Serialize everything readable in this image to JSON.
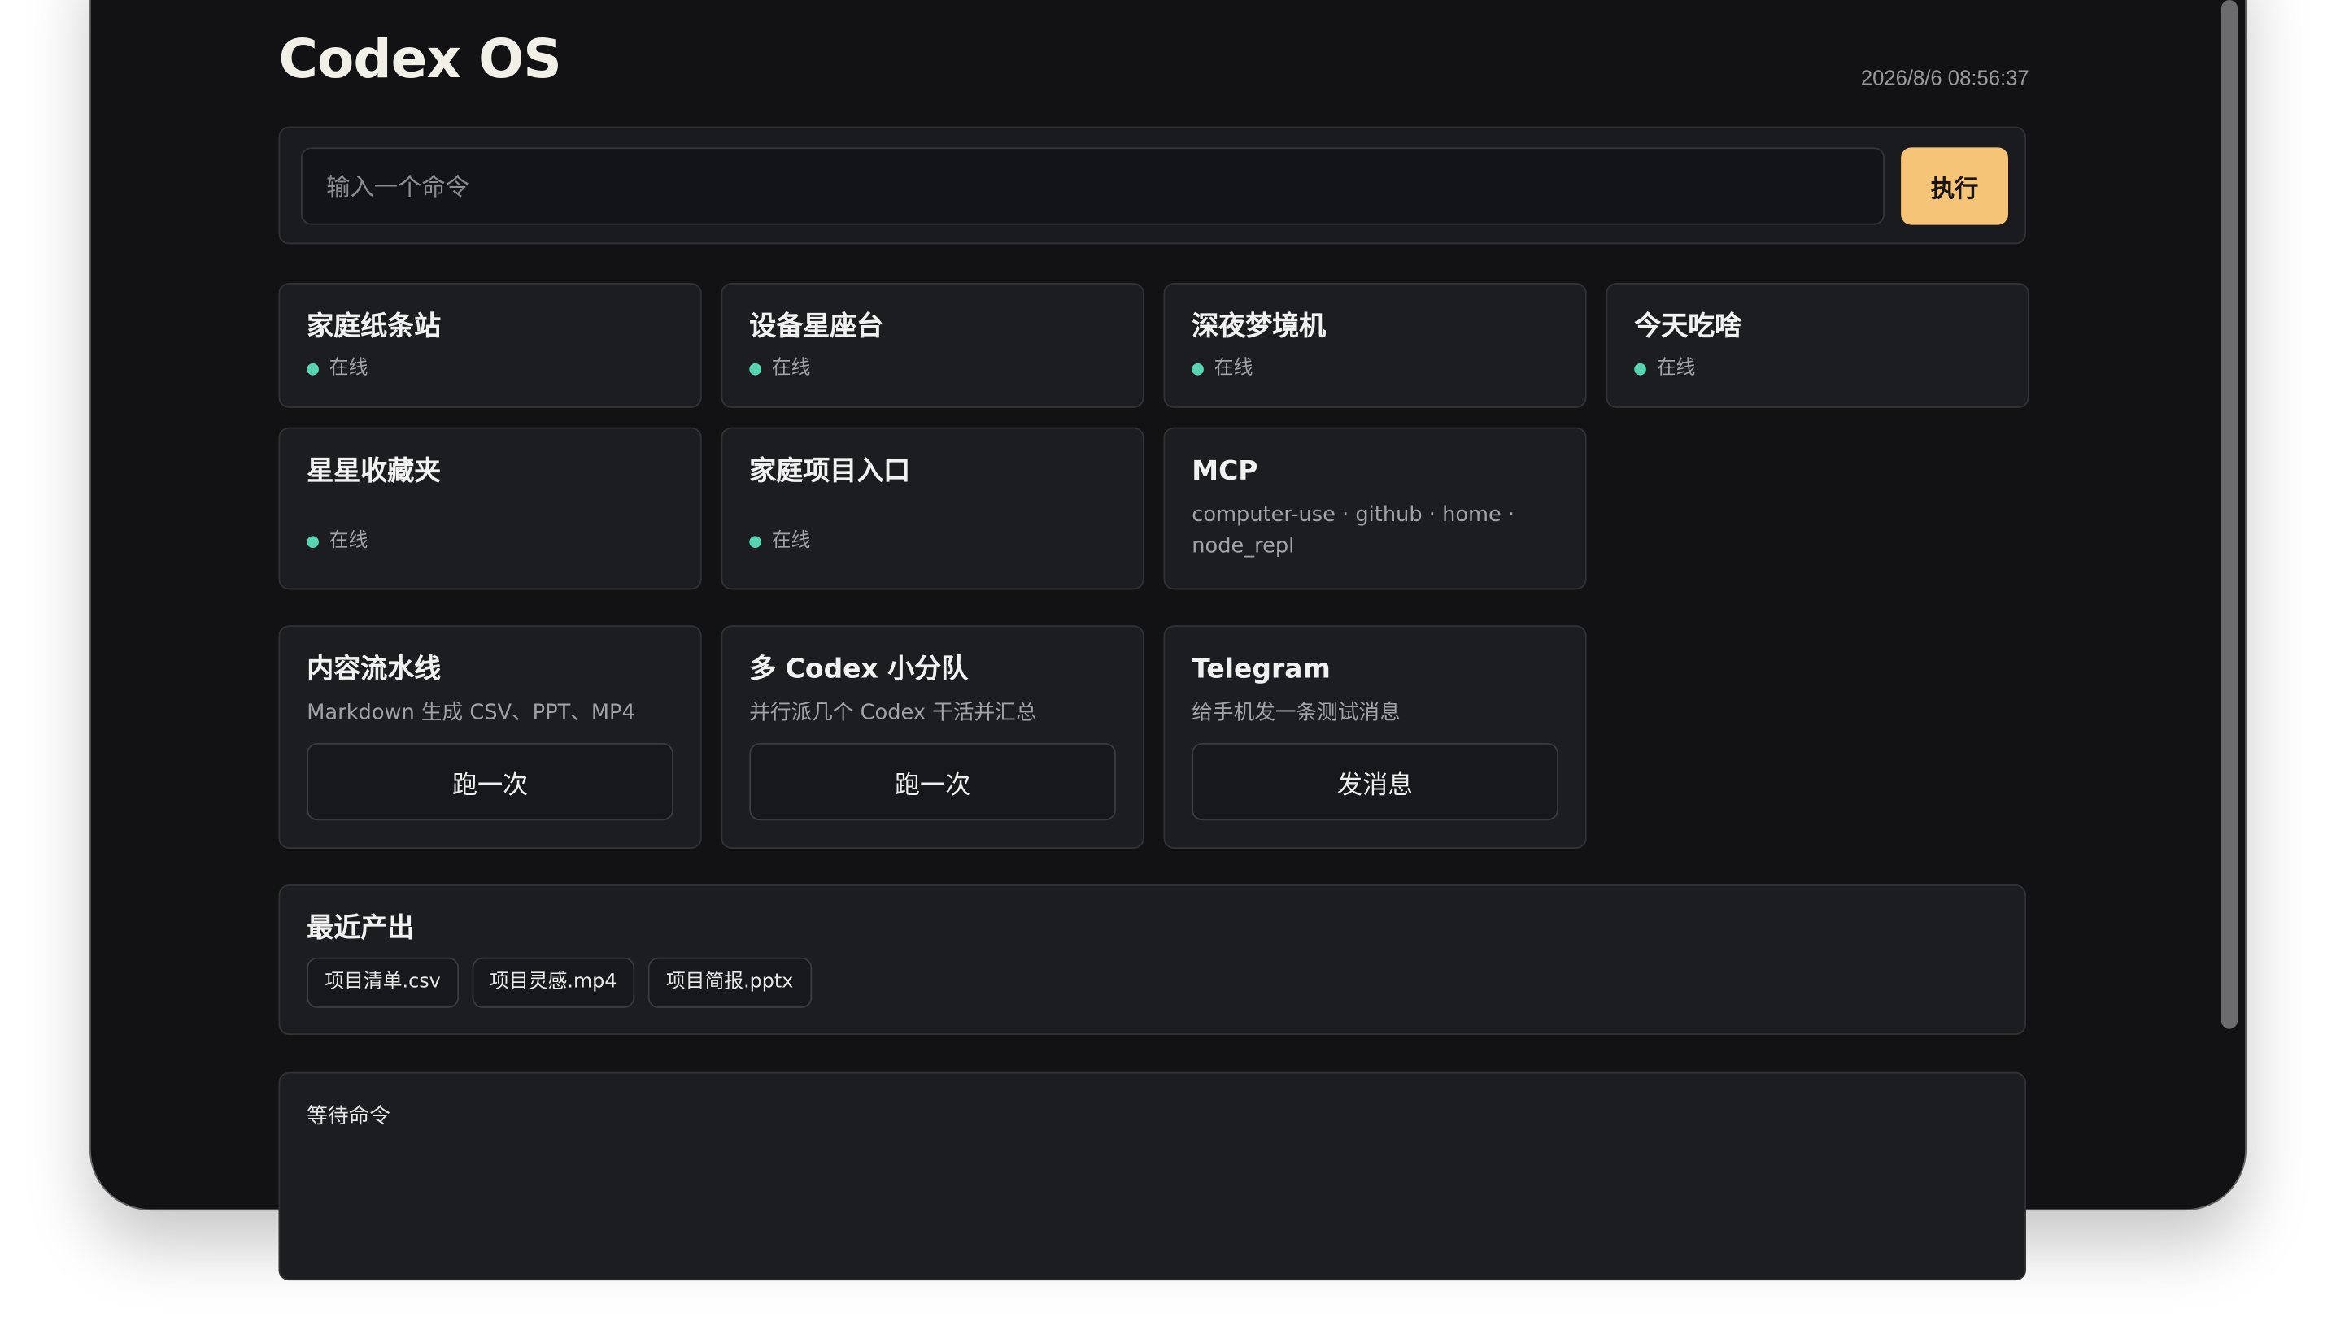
{
  "app": {
    "title": "Codex OS",
    "datetime": "2026/8/6 08:56:37"
  },
  "command": {
    "placeholder": "输入一个命令",
    "value": "",
    "run_label": "执行"
  },
  "status_cards": [
    {
      "title": "家庭纸条站",
      "status": "在线"
    },
    {
      "title": "设备星座台",
      "status": "在线"
    },
    {
      "title": "深夜梦境机",
      "status": "在线"
    },
    {
      "title": "今天吃啥",
      "status": "在线"
    },
    {
      "title": "星星收藏夹",
      "status": "在线"
    },
    {
      "title": "家庭项目入口",
      "status": "在线"
    }
  ],
  "mcp": {
    "title": "MCP",
    "description": "computer-use · github · home · node_repl"
  },
  "action_cards": [
    {
      "title": "内容流水线",
      "description": "Markdown 生成 CSV、PPT、MP4",
      "button": "跑一次"
    },
    {
      "title": "多 Codex 小分队",
      "description": "并行派几个 Codex 干活并汇总",
      "button": "跑一次"
    },
    {
      "title": "Telegram",
      "description": "给手机发一条测试消息",
      "button": "发消息"
    }
  ],
  "recent_outputs": {
    "title": "最近产出",
    "files": [
      "项目清单.csv",
      "项目灵感.mp4",
      "项目简报.pptx"
    ]
  },
  "log": {
    "text": "等待命令"
  },
  "colors": {
    "background": "#121214",
    "panel": "#1c1d20",
    "accent": "#f5c477",
    "online": "#56d5b2"
  }
}
